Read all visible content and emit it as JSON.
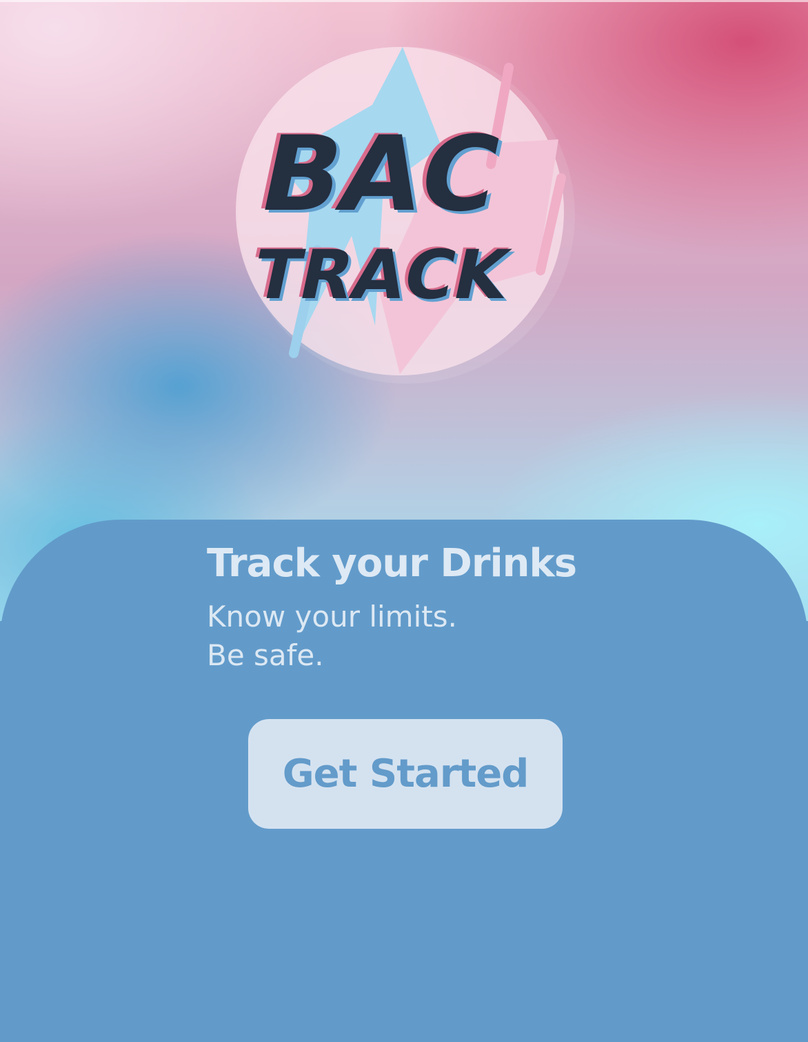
{
  "logo": {
    "line1": "BAC",
    "line2": "TRACK"
  },
  "intro": {
    "headline": "Track your Drinks",
    "sub_line1": "Know your limits.",
    "sub_line2": "Be safe."
  },
  "cta": {
    "label": "Get Started"
  },
  "colors": {
    "panel": "#629bca",
    "button_bg": "#d4e2f0",
    "button_text": "#639bca",
    "headline_text": "#dde9f4",
    "logo_text": "#242f40"
  }
}
